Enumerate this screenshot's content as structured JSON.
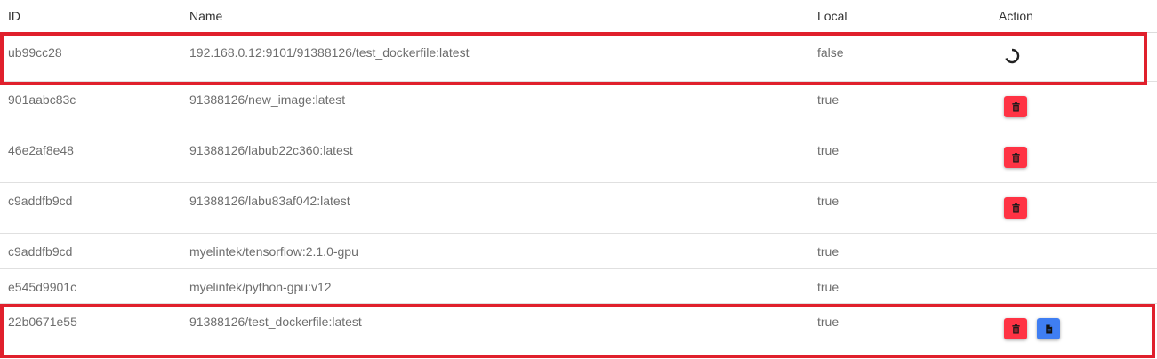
{
  "header": {
    "id_label": "ID",
    "name_label": "Name",
    "local_label": "Local",
    "action_label": "Action"
  },
  "rows": [
    {
      "id": "ub99cc28",
      "name": "192.168.0.12:9101/91388126/test_dockerfile:latest",
      "local": "false",
      "action": "loading-spinner"
    },
    {
      "id": "901aabc83c",
      "name": "91388126/new_image:latest",
      "local": "true",
      "action": "delete"
    },
    {
      "id": "46e2af8e48",
      "name": "91388126/labub22c360:latest",
      "local": "true",
      "action": "delete"
    },
    {
      "id": "c9addfb9cd",
      "name": "91388126/labu83af042:latest",
      "local": "true",
      "action": "delete"
    },
    {
      "id": "c9addfb9cd",
      "name": "myelintek/tensorflow:2.1.0-gpu",
      "local": "true",
      "action": "none"
    },
    {
      "id": "e545d9901c",
      "name": "myelintek/python-gpu:v12",
      "local": "true",
      "action": "none"
    },
    {
      "id": "22b0671e55",
      "name": "91388126/test_dockerfile:latest",
      "local": "true",
      "action": "delete+document"
    }
  ],
  "icons": {
    "delete": "trash-icon",
    "document": "document-icon",
    "loading": "spinner-icon"
  },
  "colors": {
    "delete_button": "#ff3344",
    "document_button": "#3f7ef2",
    "highlight_border": "#e0202c"
  }
}
